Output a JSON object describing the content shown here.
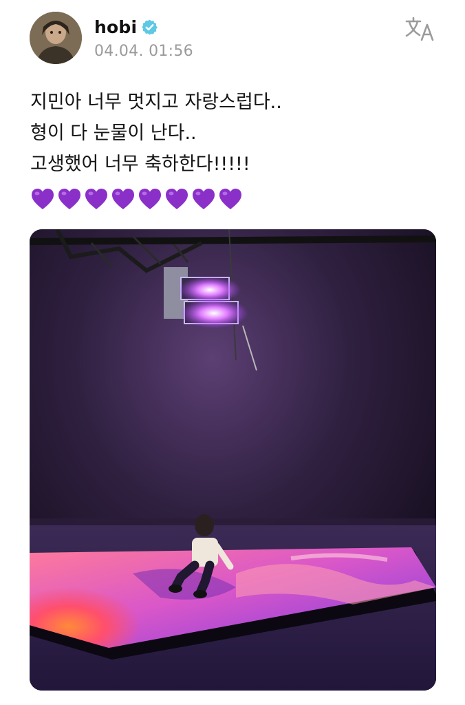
{
  "post": {
    "username": "hobi",
    "timestamp": "04.04. 01:56",
    "text_lines": [
      "지민아 너무 멋지고 자랑스럽다..",
      "형이 다 눈물이 난다..",
      "고생했어 너무 축하한다!!!!!"
    ],
    "hearts_count": 8,
    "heart_color": "#8b2fc9"
  },
  "icons": {
    "verified": "verified-badge-icon",
    "translate": "translate-icon"
  },
  "colors": {
    "verified_badge": "#5ec8e5",
    "stage_glow": "#d34fd8"
  }
}
